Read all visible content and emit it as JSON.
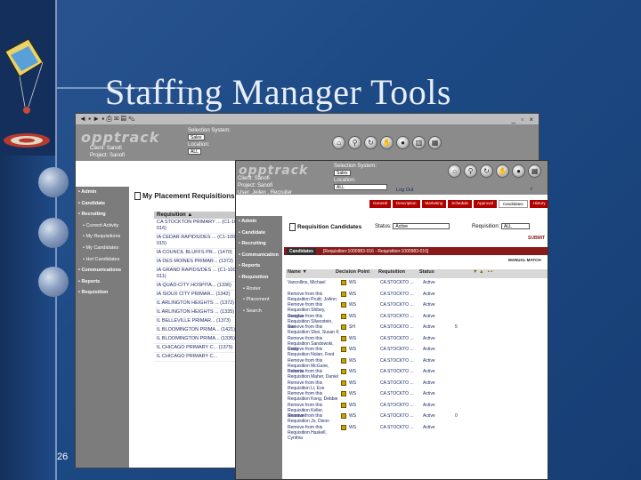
{
  "slide": {
    "title": "Staffing Manager Tools",
    "page_number": "26"
  },
  "window1": {
    "toolbar": {
      "nav": "◄ ▪ ► ▪ ⎙ ✉ ▤ ✎",
      "controls": "_ ▫ ×"
    },
    "logo": "opptrack",
    "client_label": "Client:",
    "client": "Sanofi",
    "project_label": "Project:",
    "project": "Sanofi",
    "user_label": "User:",
    "user": "Jeilen , Recruiter",
    "selection_system_label": "Selection System:",
    "selection_system": "Sales",
    "location_label": "Location:",
    "location": "ALL",
    "sidebar": [
      "• Admin",
      "• Candidate",
      "• Recruiting",
      "• Current Activity",
      "• My Requisitions",
      "• My Candidates",
      "• Hot Candidates",
      "• Communications",
      "• Reports",
      "• Requisition"
    ],
    "requisitions_title": "My Placement Requisitions",
    "req_header": "Requisition ▲",
    "requisitions": [
      "CA STOCKTON PRIMARY ... (C1-1000983-016)",
      "IA CEDAR RAPIDS/DES ... (C1-1000983-015)",
      "IA COUNCIL BLUFFS PR... (1470)",
      "IA DES MOINES PRIMAR... (1372)",
      "IA GRAND RAPIDS/DES ... (C1-1000983-011)",
      "IA QUAD-CITY HOSPITA... (1336)",
      "IA SIOUX CITY PRIMAR... (1342)",
      "IL ARLINGTON HEIGHTS ... (1372)",
      "IL ARLINGTON HEIGHTS ... (1335)",
      "IL BELLEVILLE PRIMAR... (1373)",
      "IL BLOOMINGTON PRIMA... (1421)",
      "IL BLOOMINGTON PRIMA... (1335)",
      "IL CHICAGO PRIMARY C... (1375)",
      "IL CHICAGO PRIMARY C..."
    ]
  },
  "window2": {
    "logo": "opptrack",
    "client_label": "Client:",
    "client": "Sanofi",
    "project_label": "Project:",
    "project": "Sanofi",
    "user_label": "User:",
    "user": "Jeilen , Recruiter",
    "selection_system_label": "Selection System:",
    "selection_system": "Sales",
    "location_label": "Location:",
    "location": "ALL",
    "logout": "Log Out",
    "sidebar": [
      "• Admin",
      "• Candidate",
      "• Recruiting",
      "• Communication",
      "• Reports",
      "• Requisition",
      "• Roster",
      "• Placement",
      "• Search"
    ],
    "tabs": [
      "General",
      "Description",
      "Marketing",
      "Schedule",
      "Approval",
      "Candidates",
      "History"
    ],
    "active_tab": "Candidates",
    "page_title": "Requisition Candidates",
    "status_label": "Status:",
    "status_value": "Active",
    "requisition_label": "Requisition:",
    "requisition_value": "ALL",
    "submit": "SUBMIT",
    "candidates_label": "Candidates",
    "candidates_range": "[Requisition:1000983-016 - Requisition:1000983-016]",
    "manual_match": "MANUAL MATCH",
    "columns": [
      "Name ▼",
      "Decision Point",
      "Requisition",
      "Status"
    ],
    "candidates": [
      {
        "name": "Vancollins, Michael",
        "decision": "WS",
        "req": "CA STOCKTO ...",
        "status": "Active",
        "extra": ""
      },
      {
        "name": "Remove from this Requisition Pruitt, JoAnn",
        "decision": "WS",
        "req": "CA STOCKTO ...",
        "status": "Active",
        "extra": ""
      },
      {
        "name": "Remove from this Requisition Shibey, Douglas",
        "decision": "WS",
        "req": "CA STOCKTO ...",
        "status": "Active",
        "extra": ""
      },
      {
        "name": "Remove from this Requisition Silverstein, Sue",
        "decision": "WS",
        "req": "CA STOCKTO ...",
        "status": "Active",
        "extra": ""
      },
      {
        "name": "Remove from this Requisition Shei, Susan K",
        "decision": "SH",
        "req": "CA STOCKTO ...",
        "status": "Active",
        "extra": "5"
      },
      {
        "name": "Remove from this Requisition Sandowski, Craig",
        "decision": "WS",
        "req": "CA STOCKTO ...",
        "status": "Active",
        "extra": ""
      },
      {
        "name": "Remove from this Requisition Nolan, Fred",
        "decision": "WS",
        "req": "CA STOCKTO ...",
        "status": "Active",
        "extra": ""
      },
      {
        "name": "Remove from this Requisition McGuire, Roberta",
        "decision": "WS",
        "req": "CA STOCKTO ...",
        "status": "Active",
        "extra": ""
      },
      {
        "name": "Remove from this Requisition Maher, Daniel",
        "decision": "WS",
        "req": "CA STOCKTO ...",
        "status": "Active",
        "extra": ""
      },
      {
        "name": "Remove from this Requisition Li, Eve",
        "decision": "WS",
        "req": "CA STOCKTO ...",
        "status": "Active",
        "extra": ""
      },
      {
        "name": "Remove from this Requisition Kong, Debbie",
        "decision": "WS",
        "req": "CA STOCKTO ...",
        "status": "Active",
        "extra": ""
      },
      {
        "name": "Remove from this Requisition Keller, Shannon",
        "decision": "WS",
        "req": "CA STOCKTO ...",
        "status": "Active",
        "extra": ""
      },
      {
        "name": "Remove from this Requisition Jo, Dixon",
        "decision": "WS",
        "req": "CA STOCKTO ...",
        "status": "Active",
        "extra": "0"
      },
      {
        "name": "Remove from this Requisition Haskell, Cynthia",
        "decision": "WS",
        "req": "CA STOCKTO ...",
        "status": "Active",
        "extra": ""
      }
    ]
  },
  "colors": {
    "slide_bg": "#1d4a85",
    "accent_red": "#8a1a1a",
    "link_blue": "#1c2b66"
  }
}
